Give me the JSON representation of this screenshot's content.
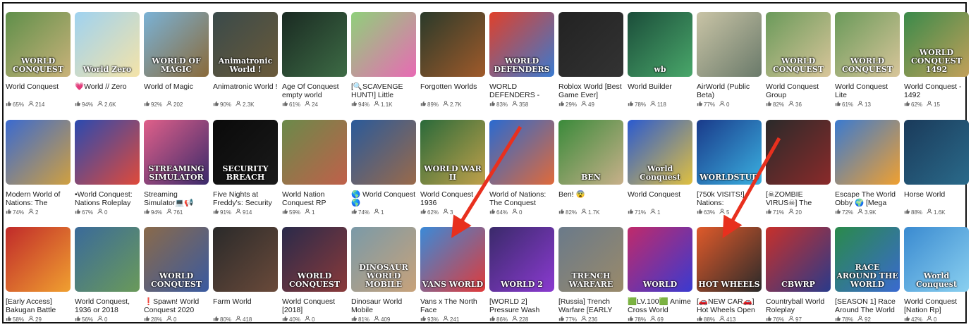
{
  "rows": [
    [
      {
        "title": "World Conquest",
        "like": "65%",
        "players": "214",
        "bg": "#5f8f4a",
        "bg2": "#c9b27a",
        "cap": "WORLD CONQUEST"
      },
      {
        "title": "💗World // Zero",
        "like": "94%",
        "players": "2.6K",
        "bg": "#9fd2f0",
        "bg2": "#f4e3a8",
        "cap": "World Zero"
      },
      {
        "title": "World of Magic",
        "like": "92%",
        "players": "202",
        "bg": "#7ab2d6",
        "bg2": "#8a6a3a",
        "cap": "WORLD OF MAGIC"
      },
      {
        "title": "Animatronic World !",
        "like": "90%",
        "players": "2.3K",
        "bg": "#3a4a4a",
        "bg2": "#6a5a3a",
        "cap": "Animatronic World !"
      },
      {
        "title": "Age Of Conquest empty world",
        "like": "61%",
        "players": "24",
        "bg": "#1a2a22",
        "bg2": "#3d6b45",
        "cap": ""
      },
      {
        "title": "[🔍SCAVENGE HUNT!] Little",
        "like": "94%",
        "players": "1.1K",
        "bg": "#8fd07a",
        "bg2": "#e86ab4",
        "cap": ""
      },
      {
        "title": "Forgotten Worlds",
        "like": "89%",
        "players": "2.7K",
        "bg": "#2a3a2a",
        "bg2": "#a05a2a",
        "cap": ""
      },
      {
        "title": "WORLD DEFENDERS -",
        "like": "83%",
        "players": "358",
        "bg": "#e0402a",
        "bg2": "#3a7ad0",
        "cap": "WORLD DEFENDERS"
      },
      {
        "title": "Roblox World [Best Game Ever]",
        "like": "29%",
        "players": "49",
        "bg": "#222222",
        "bg2": "#333333",
        "cap": ""
      },
      {
        "title": "World Builder",
        "like": "78%",
        "players": "118",
        "bg": "#1b4d3a",
        "bg2": "#49a76a",
        "cap": "wb"
      },
      {
        "title": "AirWorld (Public Beta)",
        "like": "77%",
        "players": "0",
        "bg": "#c9c4a6",
        "bg2": "#6a7a6a",
        "cap": ""
      },
      {
        "title": "World Conquest Group",
        "like": "82%",
        "players": "36",
        "bg": "#6a9a5a",
        "bg2": "#d8c59a",
        "cap": "WORLD CONQUEST"
      },
      {
        "title": "World Conquest Lite",
        "like": "61%",
        "players": "13",
        "bg": "#6a9a5a",
        "bg2": "#d8c59a",
        "cap": "WORLD CONQUEST"
      },
      {
        "title": "World Conquest - 1492",
        "like": "62%",
        "players": "15",
        "bg": "#3a8a4a",
        "bg2": "#c2a05a",
        "cap": "WORLD CONQUEST 1492"
      }
    ],
    [
      {
        "title": "Modern World of Nations: The",
        "like": "74%",
        "players": "2",
        "bg": "#3a6ad0",
        "bg2": "#d0a040",
        "cap": ""
      },
      {
        "title": "•World Conquest: Nations Roleplay",
        "like": "67%",
        "players": "0",
        "bg": "#2a4ab0",
        "bg2": "#e04a3a",
        "cap": ""
      },
      {
        "title": "Streaming Simulator💻📢",
        "like": "94%",
        "players": "761",
        "bg": "#e0608a",
        "bg2": "#3a2a6a",
        "cap": "STREAMING SIMULATOR"
      },
      {
        "title": "Five Nights at Freddy's: Security",
        "like": "91%",
        "players": "914",
        "bg": "#0a0a0a",
        "bg2": "#1a1a1a",
        "cap": "SECURITY BREACH"
      },
      {
        "title": "World Nation Conquest RP",
        "like": "59%",
        "players": "1",
        "bg": "#6a8a4a",
        "bg2": "#c0604a",
        "cap": ""
      },
      {
        "title": "🌎 World Conquest 🌎",
        "like": "74%",
        "players": "1",
        "bg": "#2a5a9a",
        "bg2": "#9a6a4a",
        "cap": ""
      },
      {
        "title": "World Conquest 1936",
        "like": "62%",
        "players": "3",
        "bg": "#2a6a3a",
        "bg2": "#c0a04a",
        "cap": "WORLD WAR II"
      },
      {
        "title": "World of Nations: The Conquest",
        "like": "64%",
        "players": "0",
        "bg": "#2a6ad0",
        "bg2": "#e06a3a",
        "cap": ""
      },
      {
        "title": "Ben! 😨",
        "like": "82%",
        "players": "1.7K",
        "bg": "#3a8a3a",
        "bg2": "#c8b08a",
        "cap": "BEN"
      },
      {
        "title": "World Conquest",
        "like": "71%",
        "players": "1",
        "bg": "#2a5ad0",
        "bg2": "#e0c040",
        "cap": "World Conquest"
      },
      {
        "title": "[750k VISITS!] Nations:",
        "like": "63%",
        "players": "5",
        "bg": "#1a3a8a",
        "bg2": "#3ab0e0",
        "cap": "WORLDSTUD"
      },
      {
        "title": "[☠ZOMBIE VIRUS☠] The",
        "like": "71%",
        "players": "20",
        "bg": "#2a2a2a",
        "bg2": "#8a2a2a",
        "cap": ""
      },
      {
        "title": "Escape The World Obby 🌍 [Mega",
        "like": "72%",
        "players": "3.9K",
        "bg": "#3a7ad0",
        "bg2": "#f0a030",
        "cap": ""
      },
      {
        "title": "Horse World",
        "like": "88%",
        "players": "1.6K",
        "bg": "#1a3a5a",
        "bg2": "#2a6a8a",
        "cap": ""
      }
    ],
    [
      {
        "title": "[Early Access] Bakugan Battle",
        "like": "58%",
        "players": "29",
        "bg": "#c02a2a",
        "bg2": "#f0a030",
        "cap": ""
      },
      {
        "title": "World Conquest, 1936 or 2018",
        "like": "56%",
        "players": "0",
        "bg": "#3a6a9a",
        "bg2": "#6a9a5a",
        "cap": ""
      },
      {
        "title": "❗Spawn! World Conquest 2020",
        "like": "28%",
        "players": "0",
        "bg": "#8a6a4a",
        "bg2": "#3a5aa0",
        "cap": "WORLD CONQUEST"
      },
      {
        "title": "Farm World",
        "like": "80%",
        "players": "418",
        "bg": "#2a2a2a",
        "bg2": "#6a4a3a",
        "cap": ""
      },
      {
        "title": "World Conquest [2018]",
        "like": "40%",
        "players": "0",
        "bg": "#2a2a4a",
        "bg2": "#8a3a3a",
        "cap": "WORLD CONQUEST"
      },
      {
        "title": "Dinosaur World Mobile",
        "like": "81%",
        "players": "409",
        "bg": "#7a9aa8",
        "bg2": "#c8a27a",
        "cap": "DINOSAUR WORLD MOBILE"
      },
      {
        "title": "Vans x The North Face",
        "like": "93%",
        "players": "241",
        "bg": "#3a8ad8",
        "bg2": "#e03a3a",
        "cap": "VANS WORLD"
      },
      {
        "title": "[WORLD 2] Pressure Wash",
        "like": "86%",
        "players": "228",
        "bg": "#3a2a6a",
        "bg2": "#8a3ad0",
        "cap": "WORLD 2"
      },
      {
        "title": "[Russia] Trench Warfare [EARLY",
        "like": "77%",
        "players": "236",
        "bg": "#6a7a8a",
        "bg2": "#9a8a6a",
        "cap": "TRENCH WARFARE"
      },
      {
        "title": "🟩LV.100🟩 Anime Cross World",
        "like": "78%",
        "players": "69",
        "bg": "#c02a6a",
        "bg2": "#3a3ad0",
        "cap": "WORLD"
      },
      {
        "title": "[🚗NEW CAR🚗] Hot Wheels Open",
        "like": "88%",
        "players": "413",
        "bg": "#e05a2a",
        "bg2": "#2a2a2a",
        "cap": "HOT WHEELS"
      },
      {
        "title": "Countryball World Roleplay",
        "like": "76%",
        "players": "97",
        "bg": "#c8302a",
        "bg2": "#2a3a8a",
        "cap": "CBWRP"
      },
      {
        "title": "[SEASON 1] Race Around The World",
        "like": "78%",
        "players": "92",
        "bg": "#2a8a4a",
        "bg2": "#3a6ad0",
        "cap": "RACE AROUND THE WORLD"
      },
      {
        "title": "World Conquest [Nation Rp]",
        "like": "42%",
        "players": "0",
        "bg": "#3a8ad0",
        "bg2": "#8ad0f0",
        "cap": "World Conquest"
      }
    ]
  ]
}
